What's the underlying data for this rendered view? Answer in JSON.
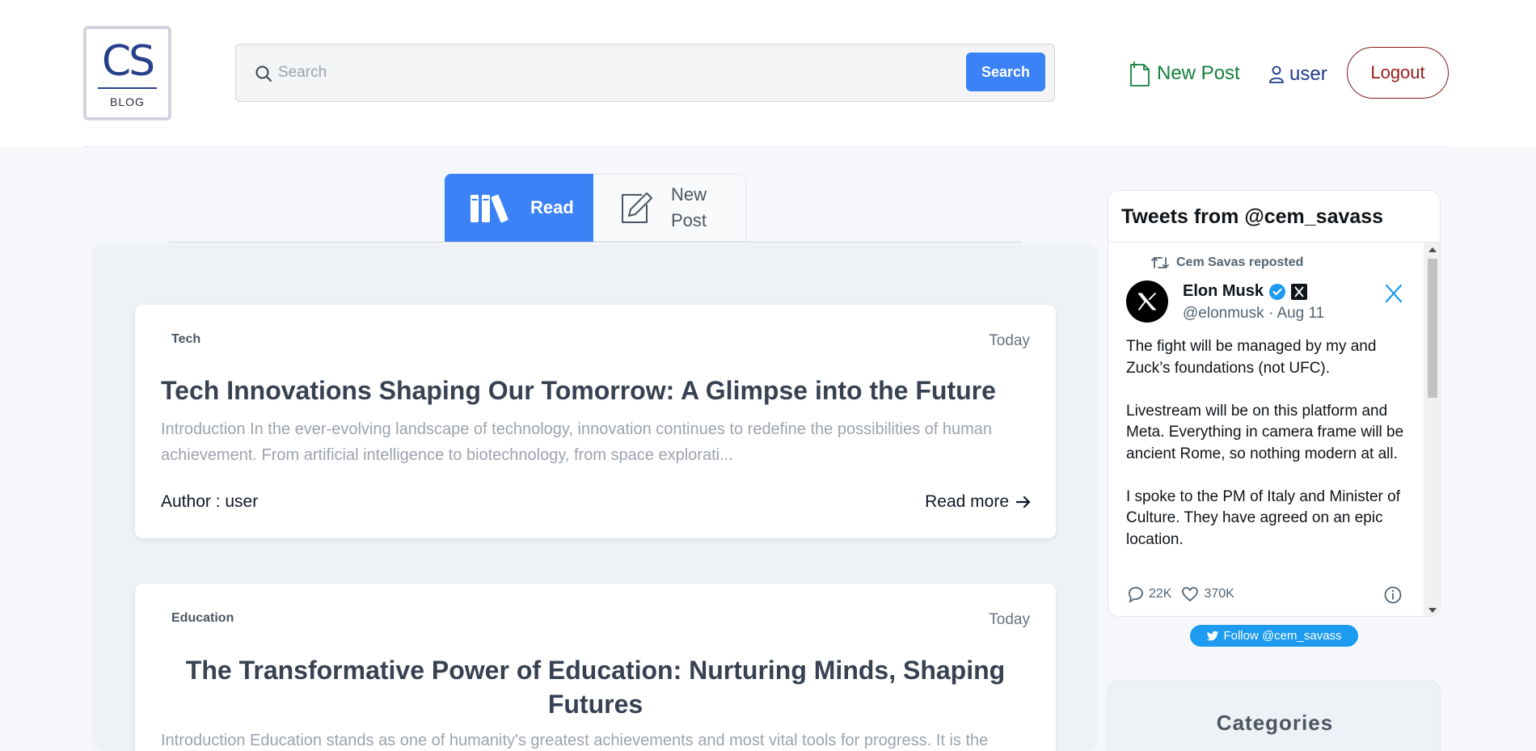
{
  "header": {
    "logo_text": "CS",
    "logo_subtext": "BLOG",
    "search_placeholder": "Search",
    "search_button": "Search",
    "new_post": "New Post",
    "user": "user",
    "logout": "Logout"
  },
  "tabs": {
    "read": "Read",
    "new_post": "New Post"
  },
  "posts": [
    {
      "category": "Tech",
      "date": "Today",
      "title": "Tech Innovations Shaping Our Tomorrow: A Glimpse into the Future",
      "excerpt": "Introduction In the ever-evolving landscape of technology, innovation continues to redefine the possibilities of human achievement. From artificial intelligence to biotechnology, from space explorati...",
      "author": "Author : user",
      "read_more": "Read more"
    },
    {
      "category": "Education",
      "date": "Today",
      "title": "The Transformative Power of Education: Nurturing Minds, Shaping Futures",
      "excerpt": "Introduction Education stands as one of humanity's greatest achievements and most vital tools for progress. It is the"
    }
  ],
  "twitter": {
    "title": "Tweets from @cem_savass",
    "repost": "Cem Savas reposted",
    "name": "Elon Musk",
    "handle": "@elonmusk · Aug 11",
    "text": "The fight will be managed by my and Zuck’s foundations (not UFC).\n\nLivestream will be on this platform and Meta. Everything in camera frame will be ancient Rome, so nothing modern at all.\n\nI spoke to the PM of Italy and Minister of Culture. They have agreed on an epic location.",
    "replies": "22K",
    "likes": "370K",
    "follow": "Follow @cem_savass"
  },
  "sidebar": {
    "categories_title": "Categories"
  },
  "colors": {
    "primary": "#3b82f6",
    "new_post_green": "#15803d",
    "user_blue": "#1e3a8a",
    "logout_red": "#991b1b",
    "twitter_blue": "#1d9bf0"
  }
}
